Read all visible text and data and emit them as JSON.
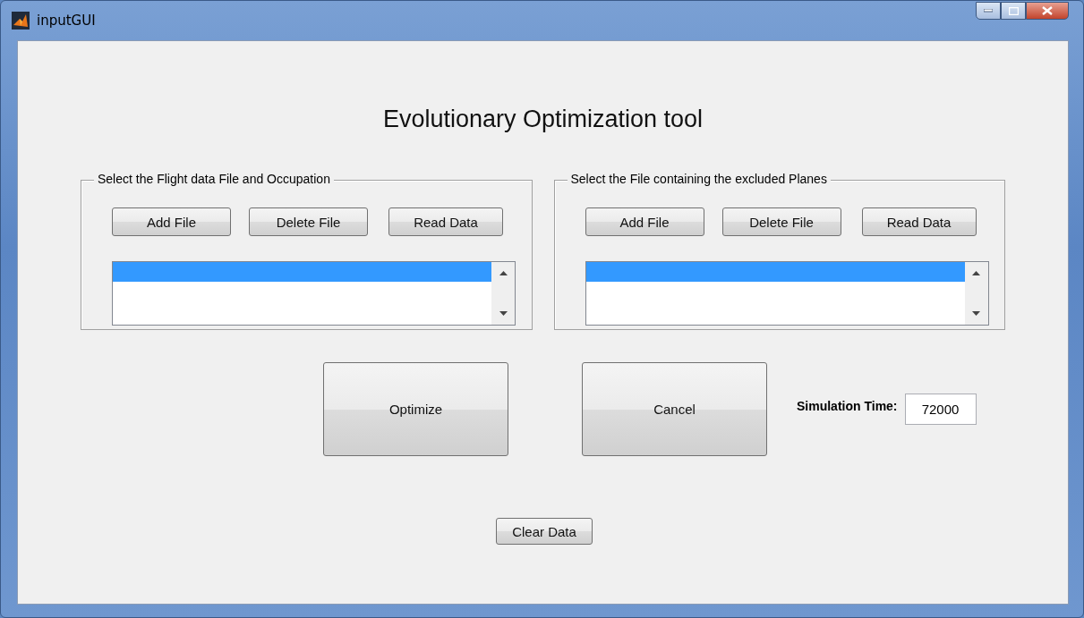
{
  "window": {
    "title": "inputGUI",
    "controls": [
      {
        "kind": "minimize"
      },
      {
        "kind": "maximize"
      },
      {
        "kind": "close"
      }
    ]
  },
  "heading": "Evolutionary Optimization tool",
  "panels": [
    {
      "title": "Select the Flight data File and Occupation",
      "buttons": [
        "Add File",
        "Delete File",
        "Read Data"
      ],
      "listbox": {
        "items": [
          {
            "selected": true
          }
        ]
      }
    },
    {
      "title": "Select the File containing the excluded Planes",
      "buttons": [
        "Add File",
        "Delete File",
        "Read Data"
      ],
      "listbox": {
        "items": [
          {
            "selected": true
          }
        ]
      }
    }
  ],
  "actions": [
    "Optimize",
    "Cancel"
  ],
  "simulation_time": {
    "label": "Simulation Time:",
    "value": "72000"
  },
  "clear_button": "Clear Data"
}
